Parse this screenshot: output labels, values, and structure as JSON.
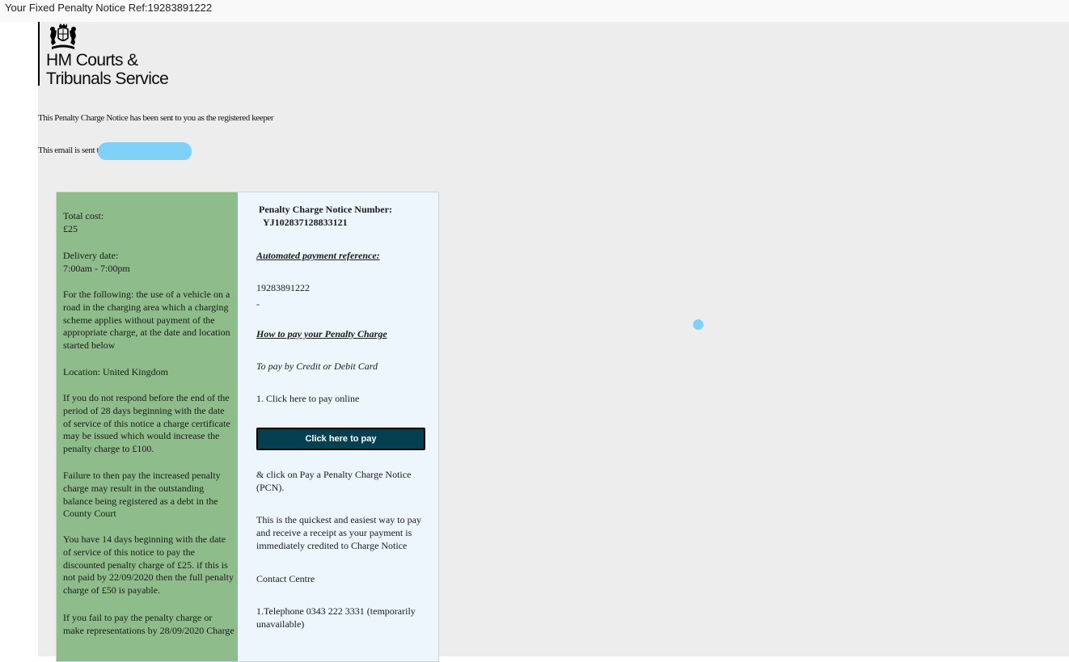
{
  "window": {
    "title": "Your Fixed Penalty Notice Ref:19283891222"
  },
  "brand": {
    "line1": "HM Courts &",
    "line2": "Tribunals Service",
    "crest_icon": "royal-coat-of-arms-icon"
  },
  "intro": {
    "line1": "This Penalty Charge Notice has been sent to you as the registered  keeper",
    "line2": "This email is sent t",
    "redaction_color": "#7fd1f7"
  },
  "left": {
    "total_cost_label": "Total cost:",
    "total_cost_value": "£25",
    "delivery_label": "Delivery date:",
    "delivery_value": "7:00am - 7:00pm",
    "offence": "For the following: the use of a vehicle on a road in the charging area which a charging scheme applies without payment of the appropriate charge, at the date and location started below",
    "location": "Location: United Kingdom",
    "warning_28_days": "If you do not respond before the end of the period of 28 days beginning with the date of service of this notice a charge certificate may be issued which would increase the penalty charge to £100.",
    "failure": "Failure to then pay the increased penalty charge may result in the outstanding balance being registered as a debt in the County Court",
    "discount": "You have 14 days beginning with the date of service of this notice to pay the discounted penalty charge of £25. if this is not paid by 22/09/2020 then the full penalty charge of £50 is payable.",
    "representations": "If you fail to pay the penalty charge or make representations by 28/09/2020 Charge",
    "background": "#8fbc8b"
  },
  "right": {
    "pcn_label": "Penalty Charge Notice Number:",
    "pcn_number": "YJ102837128833121",
    "auto_ref_heading": "Automated payment reference:",
    "auto_ref_value": "19283891222",
    "dash": "-",
    "how_to_pay_heading": "How to pay your Penalty Charge",
    "card_label": "To pay by Credit or Debit Card",
    "step1": "1. Click here to pay online",
    "pay_button": "Click here to pay",
    "click_pcn": "& click on Pay a Penalty Charge Notice (PCN).",
    "quickest": "This is the quickest and easiest way to pay and receive a receipt as your payment is immediately credited to Charge Notice",
    "contact": "Contact Centre",
    "telephone": "1.Telephone 0343 222 3331 (temporarily unavailable)",
    "background": "#eef6fd",
    "button_color": "#034052"
  }
}
